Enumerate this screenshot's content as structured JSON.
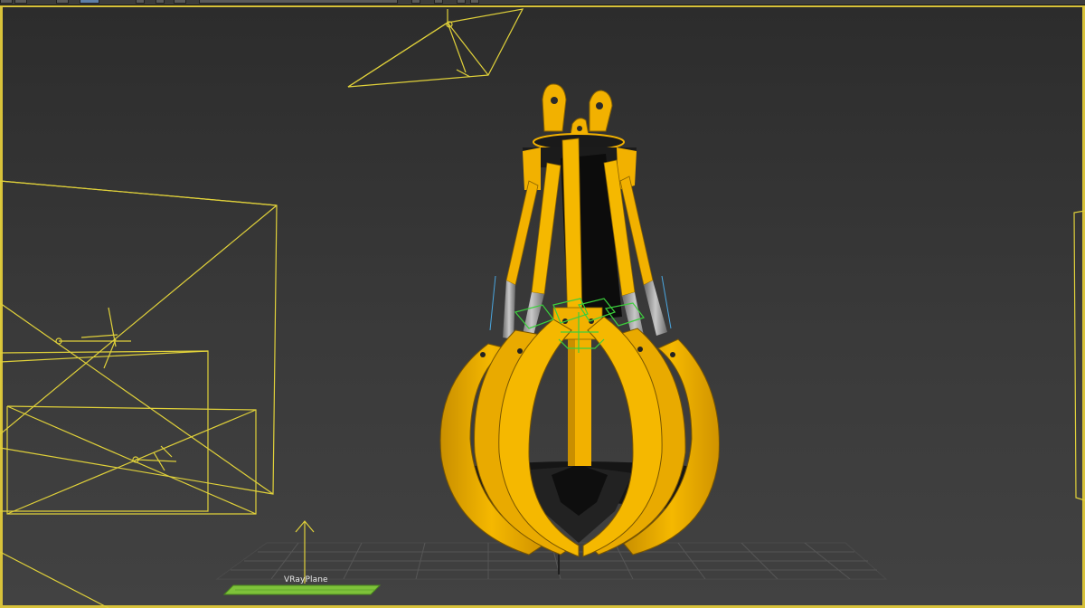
{
  "toolbar": {
    "active_color": "#5e7fa8",
    "button_color": "#5b5b5b"
  },
  "viewport": {
    "border_color": "#d8c23a",
    "background_top": "#2c2c2c",
    "background_bottom": "#424242",
    "wireframe_color": "#e0d13a"
  },
  "scene": {
    "model_color": "#f2b100",
    "model_shadow_color": "#b07f00",
    "rod_color": "#9a9a9a",
    "plane_color": "#7ec23a",
    "gizmo_color": "#3ccf3c",
    "ground_grid_color": "#5a5a5a"
  },
  "objects": {
    "plane_label": "VRayPlane"
  }
}
